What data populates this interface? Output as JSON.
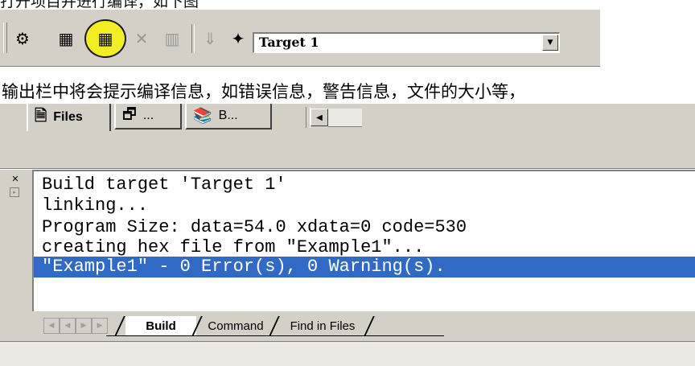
{
  "top_caption": "打开项目并进行编译，如下图",
  "toolbar": {
    "buttons": [
      {
        "name": "translate-icon",
        "glyph": "⚙"
      },
      {
        "name": "build-target-icon",
        "glyph": "▦"
      },
      {
        "name": "rebuild-all-icon",
        "glyph": "▦"
      },
      {
        "name": "stop-build-icon",
        "glyph": "✕"
      },
      {
        "name": "flash-disabled-icon",
        "glyph": "▥"
      },
      {
        "name": "download-disabled-icon",
        "glyph": "⇓"
      },
      {
        "name": "target-options-icon",
        "glyph": "✦"
      }
    ],
    "target_value": "Target 1",
    "dropdown_arrow": "▼",
    "highlight_color": "#f2ee23"
  },
  "caption": "输出栏中将会提示编译信息，如错误信息，警告信息，文件的大小等，",
  "project_tabs": {
    "files": {
      "label": "Files",
      "icon": "🗎"
    },
    "functions": {
      "label": "...",
      "icon": "🗗"
    },
    "books": {
      "label": "B...",
      "icon": "📚"
    },
    "scroll_left": "◀"
  },
  "output": {
    "close_glyph": "✕",
    "pin_glyph": "▸",
    "lines": [
      "Build target 'Target 1'",
      "linking...",
      "Program Size: data=54.0 xdata=0 code=530",
      "creating hex file from \"Example1\"...",
      "\"Example1\" - 0 Error(s), 0 Warning(s)."
    ],
    "selection_color": "#316ac5",
    "tabs": {
      "build": "Build",
      "command": "Command",
      "find": "Find in Files"
    },
    "nav": {
      "first": "◀",
      "prev": "◀",
      "next": "▶",
      "last": "▶"
    }
  }
}
